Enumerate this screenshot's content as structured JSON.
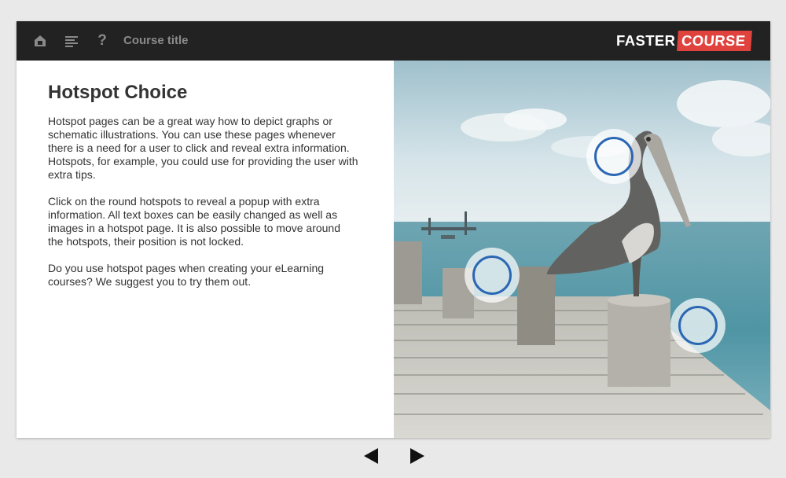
{
  "topbar": {
    "icons": [
      "home-icon",
      "menu-icon",
      "help-icon"
    ],
    "help_glyph": "?",
    "course_title": "Course title",
    "logo_part1": "FASTER",
    "logo_part2": "COURSE",
    "colors": {
      "bar": "#222222",
      "logo_accent": "#e0433d",
      "icon": "#8a8a8a"
    }
  },
  "main": {
    "heading": "Hotspot Choice",
    "paragraphs": [
      "Hotspot pages can be a great way how to depict graphs or schematic illustrations. You can use these pages whenever there is a need for a user to click and reveal extra information. Hotspots, for example, you could use for providing the user with extra tips.",
      "Click on the round hotspots to reveal a popup with extra information. All text boxes can be easily changed as well as images in a hotspot page. It is also possible to move around the hotspots, their position is not locked.",
      "Do you use hotspot pages when creating your eLearning courses? We suggest you to try them out."
    ]
  },
  "image": {
    "subject": "pelican on wooden pier by the sea",
    "hotspot_color": "#2c67b4",
    "hotspot_count": 3
  },
  "navigation": {
    "icons": [
      "previous-arrow-icon",
      "next-arrow-icon"
    ]
  }
}
